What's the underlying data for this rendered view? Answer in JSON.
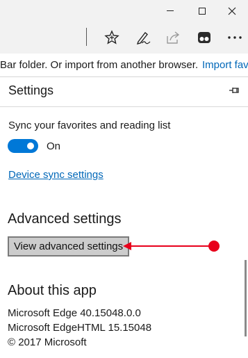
{
  "window": {
    "controls": [
      "minimize",
      "maximize",
      "close"
    ]
  },
  "toolbar": {
    "icons": [
      "favorites-star-icon",
      "pen-icon",
      "share-icon",
      "extension-icon",
      "more-icon"
    ]
  },
  "favorites_bar": {
    "text": "Bar folder. Or import from another browser.",
    "link": "Import fav"
  },
  "settings": {
    "title": "Settings",
    "sync_label": "Sync your favorites and reading list",
    "sync_toggle_state": "On",
    "device_sync_link": "Device sync settings",
    "advanced_heading": "Advanced settings",
    "advanced_button": "View advanced settings",
    "about_heading": "About this app",
    "about_lines": [
      "Microsoft Edge 40.15048.0.0",
      "Microsoft EdgeHTML 15.15048",
      "© 2017 Microsoft"
    ]
  },
  "colors": {
    "accent": "#0078d7",
    "link": "#0067b8",
    "annotation": "#e8001b"
  }
}
